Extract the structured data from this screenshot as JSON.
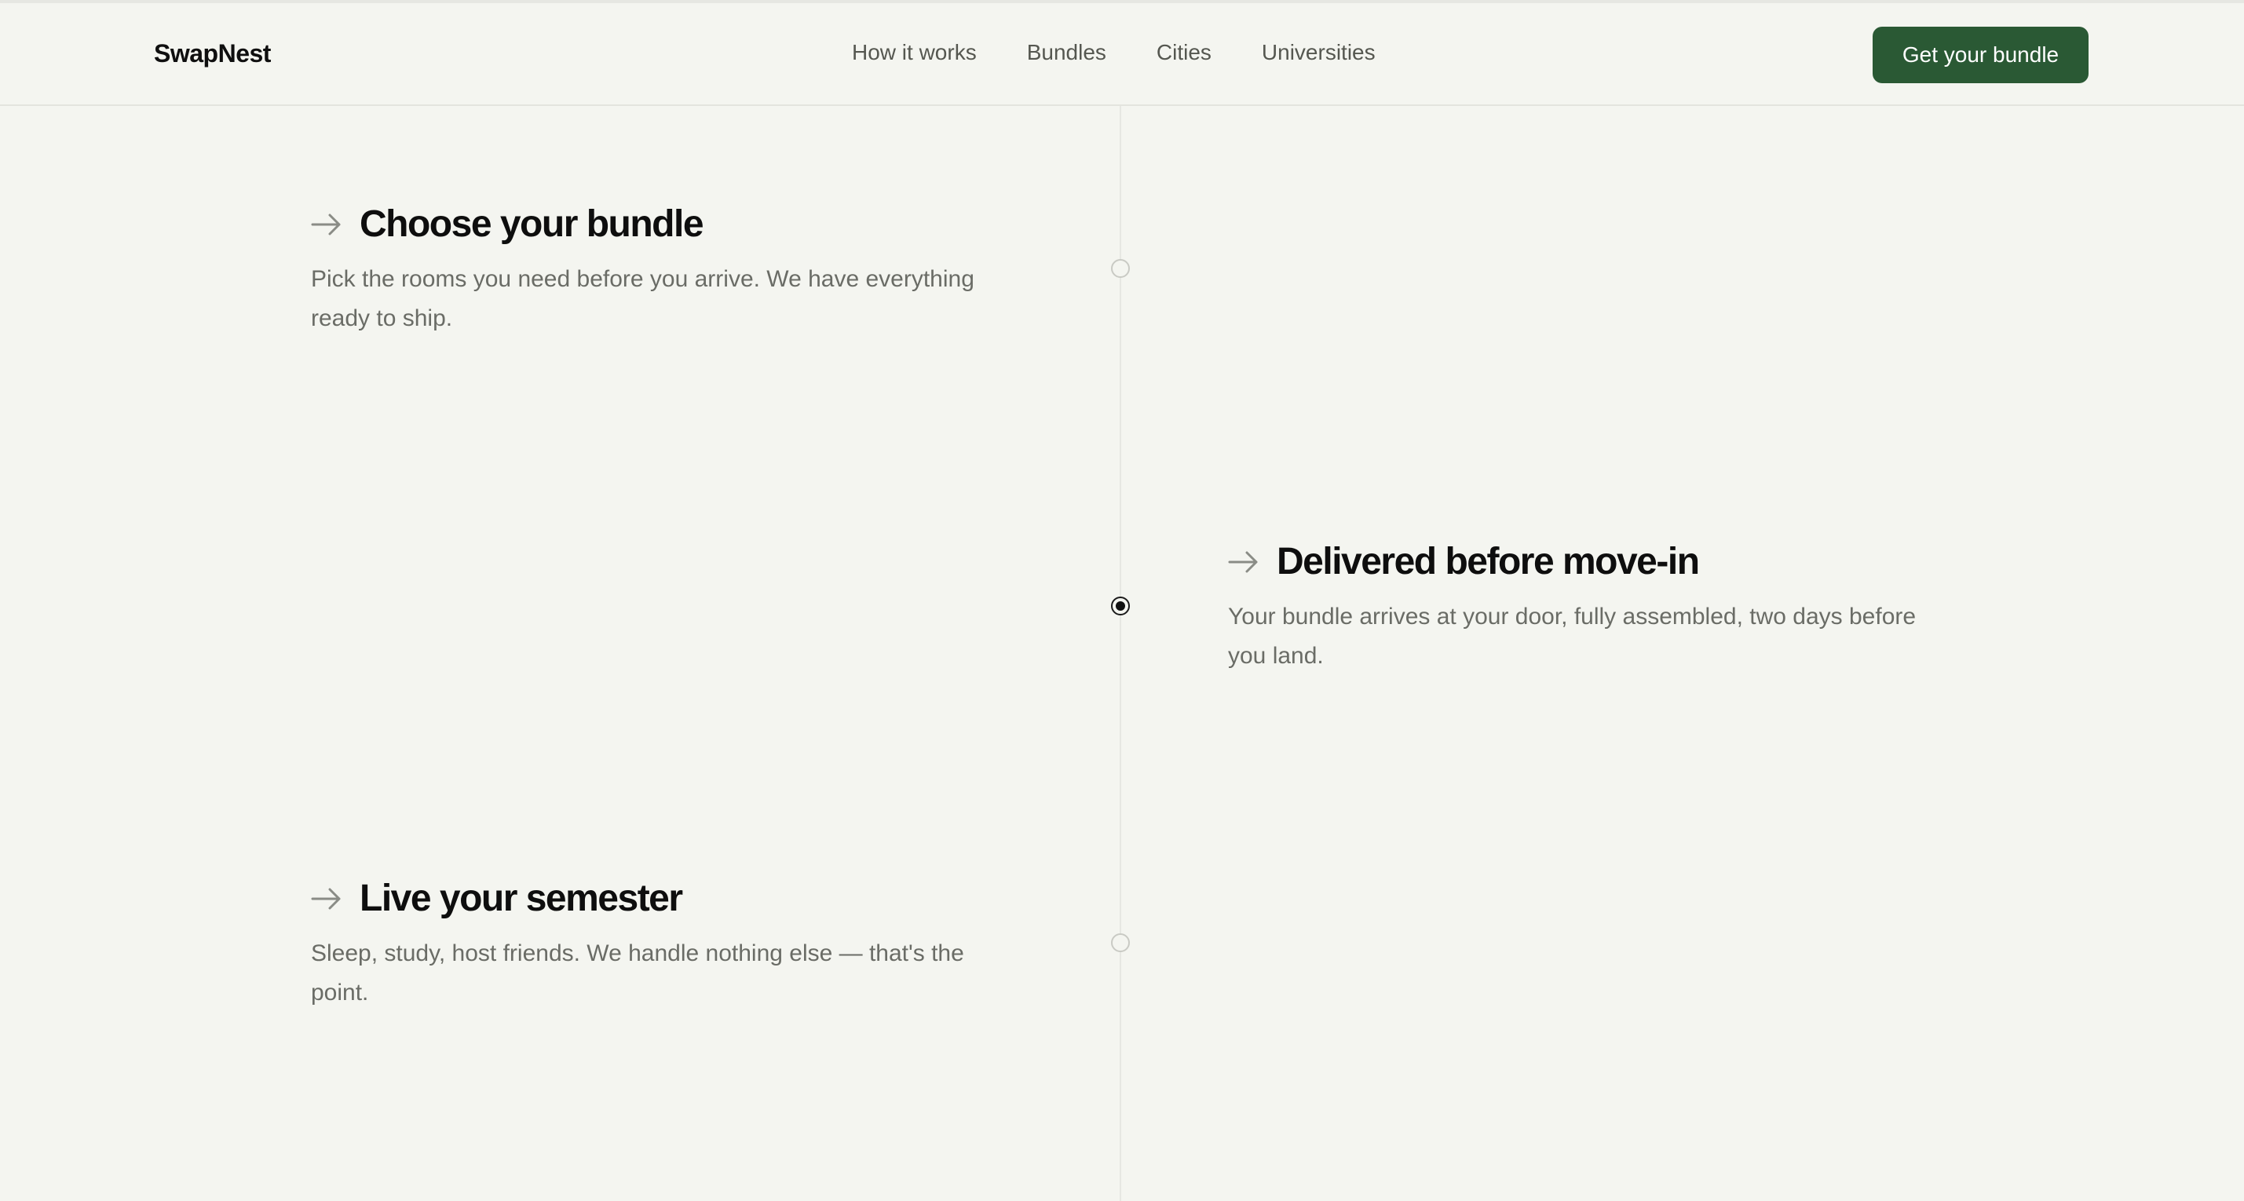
{
  "header": {
    "logo": "SwapNest",
    "nav": [
      {
        "label": "How it works"
      },
      {
        "label": "Bundles"
      },
      {
        "label": "Cities"
      },
      {
        "label": "Universities"
      }
    ],
    "cta_label": "Get your bundle"
  },
  "steps": [
    {
      "title": "Choose your bundle",
      "description": "Pick the rooms you need before you arrive. We have everything ready to ship.",
      "active": false,
      "icon": "arrow-right-icon"
    },
    {
      "title": "Delivered before move-in",
      "description": "Your bundle arrives at your door, fully assembled, two days before you land.",
      "active": true,
      "icon": "arrow-right-icon"
    },
    {
      "title": "Live your semester",
      "description": "Sleep, study, host friends. We handle nothing else — that's the point.",
      "active": false,
      "icon": "arrow-right-icon"
    }
  ],
  "colors": {
    "background": "#f4f5f0",
    "accent": "#2a5934",
    "text": "#0e0e0e",
    "muted": "#6a6c66"
  }
}
